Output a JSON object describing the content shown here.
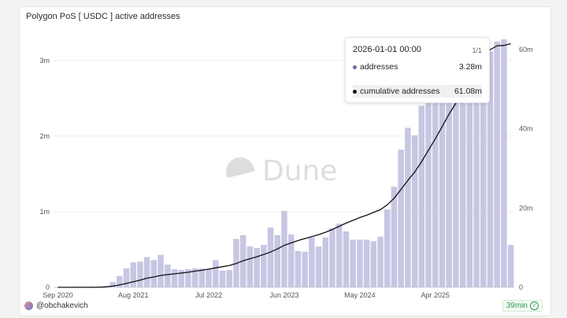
{
  "title": "Polygon PoS [ USDC ] active addresses",
  "user": "@obchakevich",
  "freshness": "39min",
  "watermark": "Dune",
  "colors": {
    "bar": "#c7c6e3",
    "line": "#111111",
    "fresh": "#2a9d4b"
  },
  "tooltip": {
    "date": "2026-01-01 00:00",
    "page": "1/1",
    "rows": [
      {
        "label": "addresses",
        "value": "3.28m",
        "color": "#6f6aa8"
      },
      {
        "label": "cumulative addresses",
        "value": "61.08m",
        "color": "#111111"
      }
    ]
  },
  "chart_data": {
    "type": "bar",
    "title": "Polygon PoS [ USDC ] active addresses",
    "x_tick_labels": [
      "Sep 2020",
      "Aug 2021",
      "Jul 2022",
      "Jun 2023",
      "May 2024",
      "Apr 2025"
    ],
    "y_left_ticks": [
      "0",
      "1m",
      "2m",
      "3m"
    ],
    "y_right_ticks": [
      "0",
      "20m",
      "40m",
      "60m"
    ],
    "ylim_left": [
      0,
      3300000
    ],
    "ylim_right": [
      0,
      63000000
    ],
    "series": [
      {
        "name": "addresses",
        "kind": "bar",
        "axis": "left",
        "values": [
          2000,
          4000,
          5000,
          6000,
          8000,
          10000,
          12000,
          20000,
          70000,
          150000,
          250000,
          330000,
          340000,
          400000,
          360000,
          430000,
          300000,
          240000,
          230000,
          240000,
          250000,
          250000,
          240000,
          360000,
          220000,
          230000,
          640000,
          690000,
          540000,
          520000,
          560000,
          790000,
          690000,
          1010000,
          700000,
          480000,
          470000,
          660000,
          540000,
          660000,
          780000,
          840000,
          740000,
          630000,
          630000,
          630000,
          610000,
          670000,
          1030000,
          1330000,
          1820000,
          2110000,
          2010000,
          2400000,
          2600000,
          2450000,
          2900000,
          3000000,
          2700000,
          2800000,
          3100000,
          3150000,
          2900000,
          3120000,
          3250000,
          3280000,
          560000
        ]
      },
      {
        "name": "cumulative addresses",
        "kind": "line",
        "axis": "right",
        "values": [
          0,
          0,
          0,
          0,
          0,
          0,
          0,
          0.1,
          0.3,
          0.6,
          1.0,
          1.4,
          1.8,
          2.3,
          2.6,
          3.0,
          3.2,
          3.4,
          3.6,
          3.8,
          4.1,
          4.3,
          4.6,
          4.9,
          5.2,
          5.5,
          6.0,
          6.7,
          7.2,
          7.7,
          8.3,
          8.9,
          9.7,
          10.6,
          11.2,
          11.8,
          12.3,
          12.8,
          13.3,
          13.9,
          14.6,
          15.4,
          16.2,
          16.9,
          17.6,
          18.2,
          18.9,
          19.6,
          20.8,
          22.5,
          24.7,
          27.0,
          29.1,
          31.7,
          34.6,
          37.5,
          40.6,
          43.7,
          46.5,
          49.3,
          52.3,
          55.3,
          57.9,
          60.0,
          61.0,
          61.08,
          61.5
        ]
      }
    ],
    "grid": true,
    "legend": "none"
  }
}
